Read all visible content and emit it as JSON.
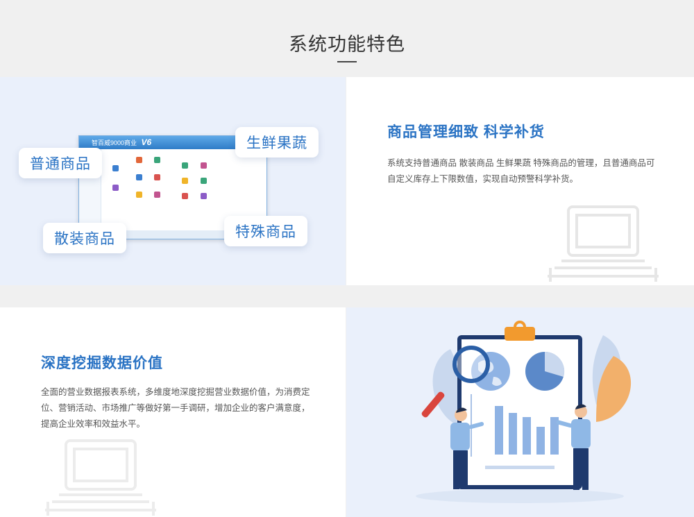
{
  "section": {
    "title": "系统功能特色"
  },
  "feature1": {
    "title": "商品管理细致 科学补货",
    "desc_line1": "系统支持普通商品 散装商品 生鲜果蔬 特殊商品的管理，且普通商品可",
    "desc_line2": "自定义库存上下限数值，实现自动预警科学补货。",
    "tags": [
      "普通商品",
      "生鲜果蔬",
      "散装商品",
      "特殊商品"
    ],
    "software_brand": "智百威9000商业",
    "software_version": "V6"
  },
  "feature2": {
    "title": "深度挖掘数据价值",
    "desc_line1": "全面的营业数据报表系统，多维度地深度挖掘营业数据价值，为消费定",
    "desc_line2": "位、营销活动、市场推广等做好第一手调研，增加企业的客户满意度，",
    "desc_line3": "提高企业效率和效益水平。"
  },
  "colors": {
    "accent": "#2a73c4",
    "panel_blue": "#eaf0fb",
    "orange": "#f29a2e",
    "navy": "#1f3a6e"
  },
  "icons": [
    "computer-outline-icon",
    "magnifier-icon",
    "globe-icon",
    "pie-chart-icon",
    "bar-chart-icon",
    "leaf-icon",
    "clipboard-icon"
  ]
}
